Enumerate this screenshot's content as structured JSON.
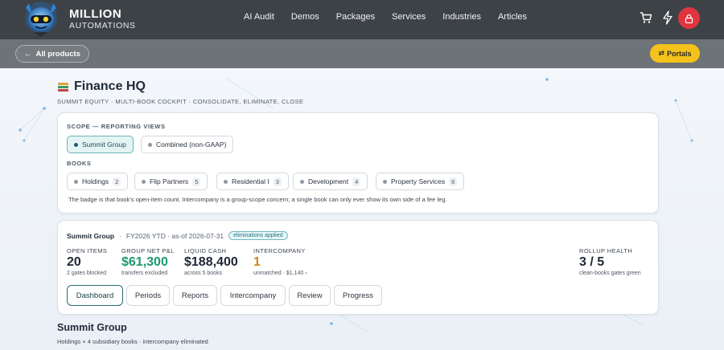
{
  "brand": {
    "line1": "MILLION",
    "line2": "AUTOMATIONS"
  },
  "nav": {
    "links": [
      "AI Audit",
      "Demos",
      "Packages",
      "Services",
      "Industries",
      "Articles"
    ],
    "icons": [
      "cart-icon",
      "bolt-icon",
      "lock-icon"
    ],
    "lock_color": "#e0353f"
  },
  "subbar": {
    "back_label": "All products",
    "portals_label": "Portals",
    "portals_color": "#f5c21b"
  },
  "page": {
    "title": "Finance HQ",
    "subtitle": "SUMMIT EQUITY · MULTI-BOOK COCKPIT · CONSOLIDATE, ELIMINATE, CLOSE"
  },
  "scope": {
    "label": "SCOPE — REPORTING VIEWS",
    "views": [
      {
        "label": "Summit Group",
        "active": true
      },
      {
        "label": "Combined (non-GAAP)",
        "active": false
      }
    ],
    "books_label": "BOOKS",
    "books": [
      {
        "label": "Holdings",
        "count": "2"
      },
      {
        "label": "Flip Partners",
        "count": "5"
      },
      {
        "label": "Residential I",
        "count": "3"
      },
      {
        "label": "Development",
        "count": "4"
      },
      {
        "label": "Property Services",
        "count": "6"
      }
    ],
    "note": "The badge is that book's open-item count. Intercompany is a group-scope concern; a single book can only ever show its own side of a fee leg."
  },
  "summary": {
    "entity": "Summit Group",
    "period": "FY2026 YTD · as-of 2026-07-31",
    "badge": "eliminations applied",
    "kpis": [
      {
        "label": "OPEN ITEMS",
        "value": "20",
        "sub": "2 gates blocked",
        "color": "#1d2733"
      },
      {
        "label": "GROUP NET P&L",
        "value": "$61,300",
        "sub": "transfers excluded",
        "color": "#1a9a6a"
      },
      {
        "label": "LIQUID CASH",
        "value": "$188,400",
        "sub": "across 5 books",
        "color": "#1d2733"
      },
      {
        "label": "INTERCOMPANY",
        "value": "1",
        "sub": "unmatched · $1,140 ›",
        "color": "#c98a1f"
      },
      {
        "label": "ROLLUP HEALTH",
        "value": "3 / 5",
        "sub": "clean-books gates green",
        "color": "#1d2733"
      }
    ],
    "tabs": [
      "Dashboard",
      "Periods",
      "Reports",
      "Intercompany",
      "Review",
      "Progress"
    ],
    "active_tab": "Dashboard"
  },
  "section": {
    "title": "Summit Group",
    "subtitle": "Holdings + 4 subsidiary books · intercompany eliminated"
  }
}
